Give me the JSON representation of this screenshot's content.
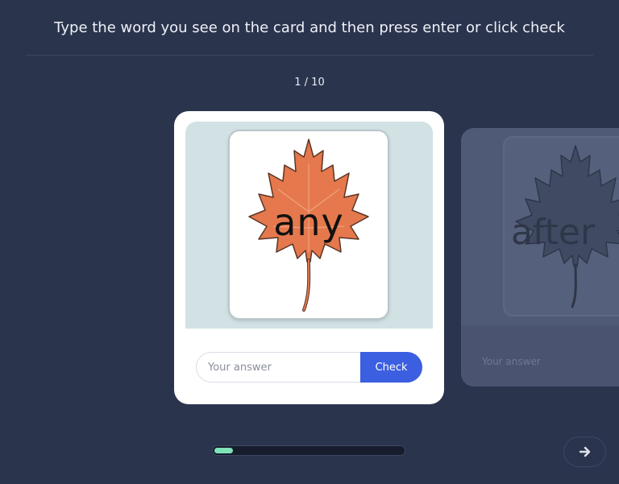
{
  "instruction": "Type the word you see on the card and then press enter or click check",
  "counter": "1 / 10",
  "current_card": {
    "word": "any",
    "image_icon": "maple-leaf-icon",
    "input": {
      "placeholder": "Your answer",
      "value": ""
    },
    "check_label": "Check"
  },
  "next_card": {
    "word": "after",
    "image_icon": "maple-leaf-icon",
    "input_placeholder": "Your answer"
  },
  "progress": {
    "fraction": 0.1
  },
  "next_button_icon": "arrow-right-icon",
  "colors": {
    "background": "#2b344d",
    "accent": "#3b5fe0",
    "leaf": "#e5784d",
    "progress": "#7ee3b8"
  }
}
